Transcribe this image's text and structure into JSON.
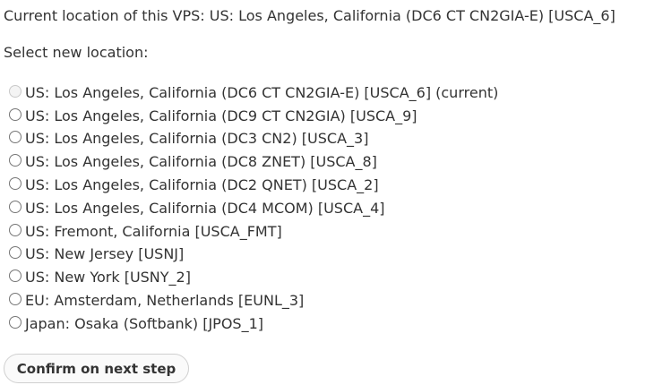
{
  "current_location": {
    "text": "Current location of this VPS: US: Los Angeles, California (DC6 CT CN2GIA-E) [USCA_6]"
  },
  "select_label": "Select new location:",
  "locations": [
    {
      "label": "US: Los Angeles, California (DC6 CT CN2GIA-E) [USCA_6] (current)",
      "disabled": true
    },
    {
      "label": "US: Los Angeles, California (DC9 CT CN2GIA) [USCA_9]",
      "disabled": false
    },
    {
      "label": "US: Los Angeles, California (DC3 CN2) [USCA_3]",
      "disabled": false
    },
    {
      "label": "US: Los Angeles, California (DC8 ZNET) [USCA_8]",
      "disabled": false
    },
    {
      "label": "US: Los Angeles, California (DC2 QNET) [USCA_2]",
      "disabled": false
    },
    {
      "label": "US: Los Angeles, California (DC4 MCOM) [USCA_4]",
      "disabled": false
    },
    {
      "label": "US: Fremont, California [USCA_FMT]",
      "disabled": false
    },
    {
      "label": "US: New Jersey [USNJ]",
      "disabled": false
    },
    {
      "label": "US: New York [USNY_2]",
      "disabled": false
    },
    {
      "label": "EU: Amsterdam, Netherlands [EUNL_3]",
      "disabled": false
    },
    {
      "label": "Japan: Osaka (Softbank) [JPOS_1]",
      "disabled": false
    }
  ],
  "confirm_button": {
    "label": "Confirm on next step"
  }
}
